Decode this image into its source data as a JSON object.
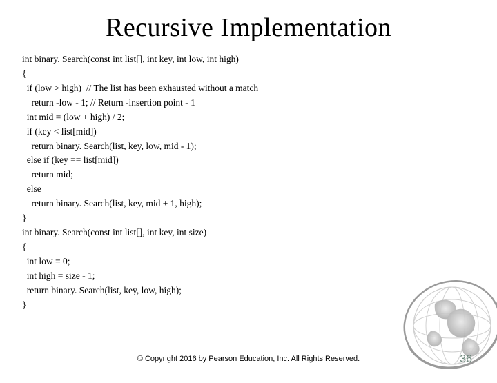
{
  "title": "Recursive Implementation",
  "code_lines": [
    "int binary. Search(const int list[], int key, int low, int high)",
    "{",
    "  if (low > high)  // The list has been exhausted without a match",
    "    return -low - 1; // Return -insertion point - 1",
    "  int mid = (low + high) / 2;",
    "  if (key < list[mid])",
    "    return binary. Search(list, key, low, mid - 1);",
    "  else if (key == list[mid])",
    "    return mid;",
    "  else",
    "    return binary. Search(list, key, mid + 1, high);",
    "}",
    "int binary. Search(const int list[], int key, int size)",
    "{",
    "  int low = 0;",
    "  int high = size - 1;",
    "  return binary. Search(list, key, low, high);",
    "}"
  ],
  "copyright": "© Copyright 2016 by Pearson Education, Inc. All Rights Reserved.",
  "page_number": "36"
}
